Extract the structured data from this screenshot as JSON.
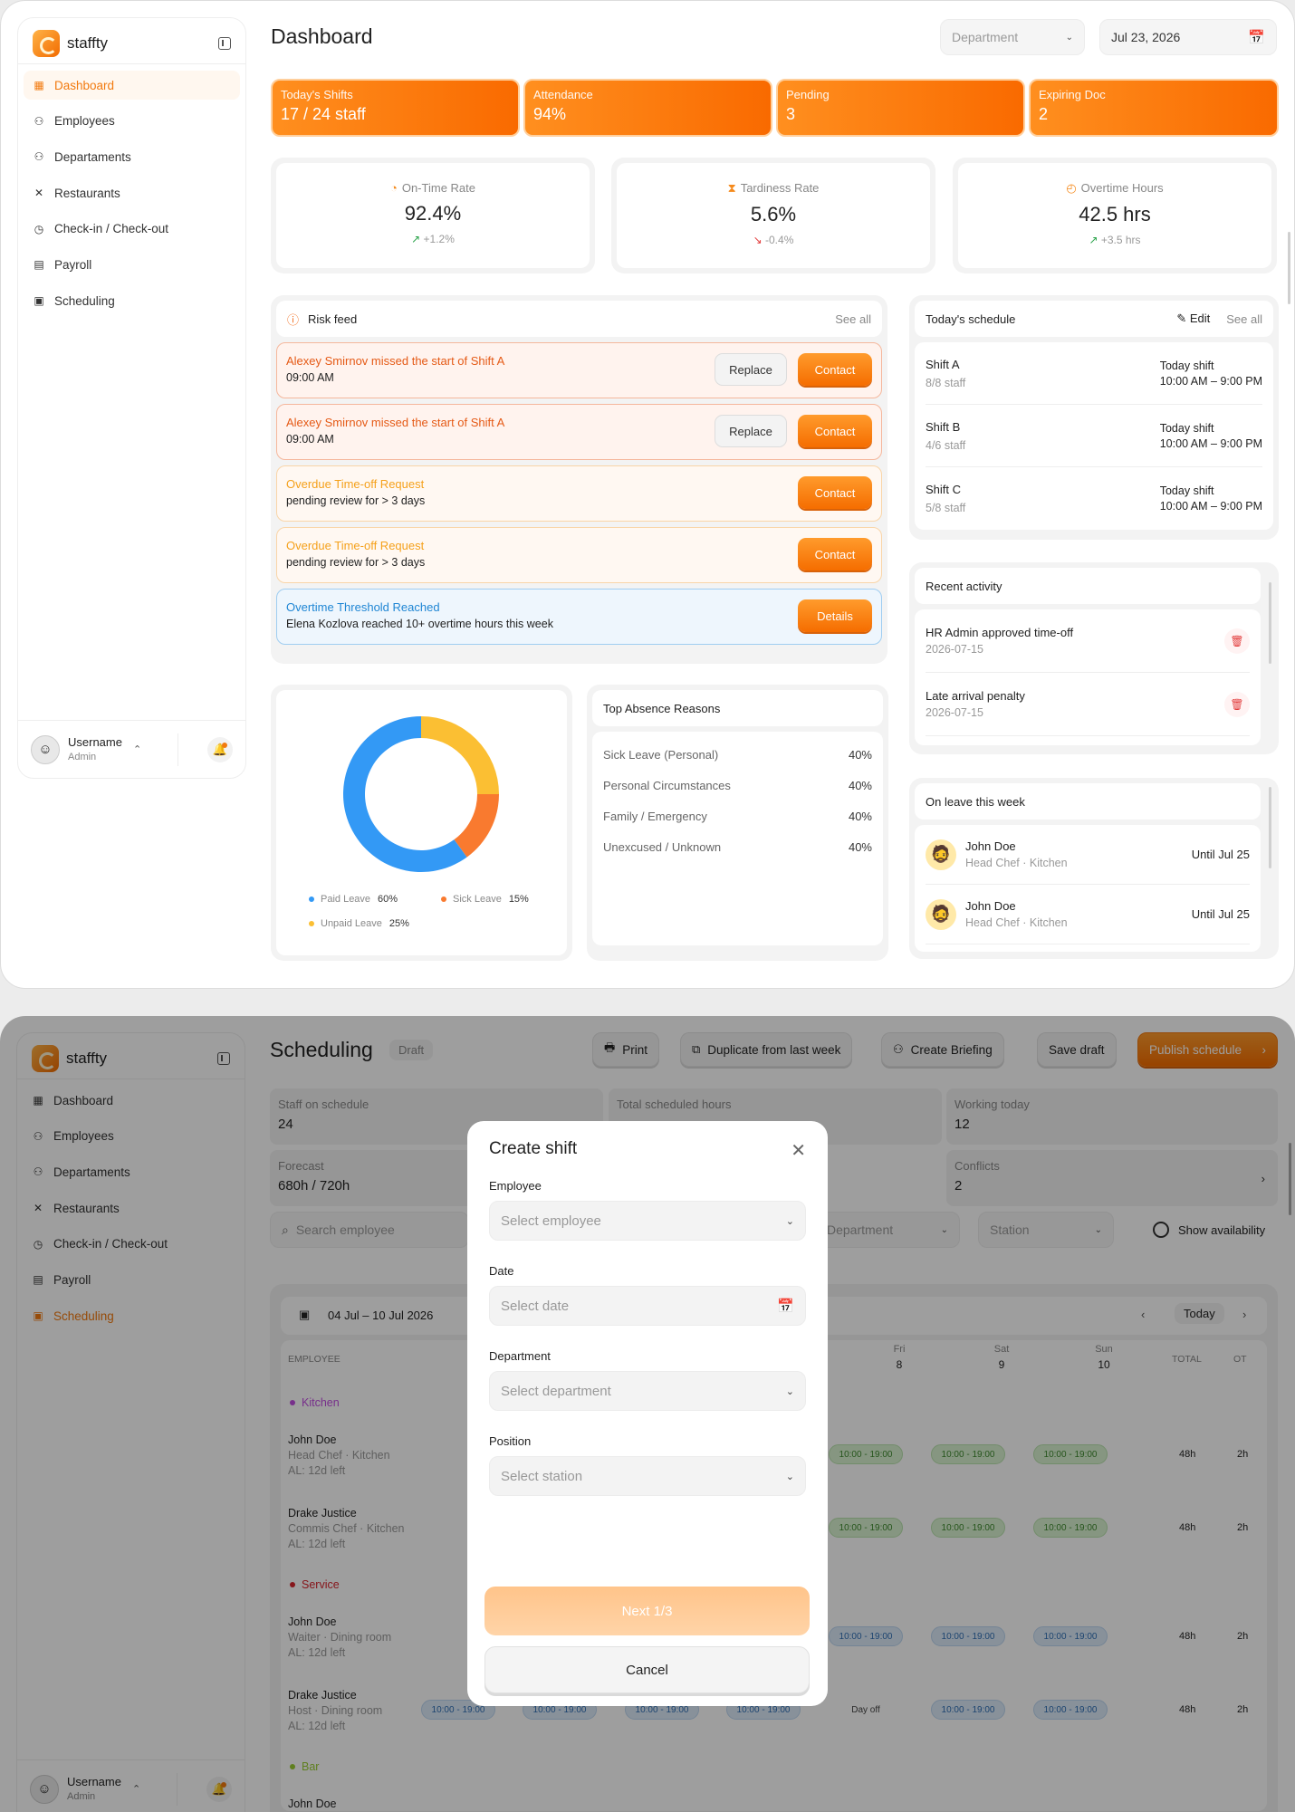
{
  "dashboard": {
    "brand": "staffty",
    "nav": [
      "Dashboard",
      "Employees",
      "Departaments",
      "Restaurants",
      "Check-in / Check-out",
      "Payroll",
      "Scheduling"
    ],
    "user": {
      "name": "Username",
      "role": "Admin"
    },
    "title": "Dashboard",
    "department_select": "Department",
    "date_select": "Jul 23, 2026",
    "kpis": [
      {
        "label": "Today's Shifts",
        "value": "17 / 24 staff"
      },
      {
        "label": "Attendance",
        "value": "94%"
      },
      {
        "label": "Pending",
        "value": "3"
      },
      {
        "label": "Expiring Doc",
        "value": "2"
      }
    ],
    "stats": [
      {
        "label": "On-Time Rate",
        "value": "92.4%",
        "delta": "+1.2%",
        "trend": "up"
      },
      {
        "label": "Tardiness Rate",
        "value": "5.6%",
        "delta": "-0.4%",
        "trend": "down"
      },
      {
        "label": "Overtime Hours",
        "value": "42.5 hrs",
        "delta": "+3.5 hrs",
        "trend": "up"
      }
    ],
    "risk_feed": {
      "title": "Risk feed",
      "see_all": "See all",
      "items": [
        {
          "title": "Alexey Smirnov missed the start of Shift A",
          "sub": "09:00 AM",
          "secondary": "Replace",
          "primary": "Contact"
        },
        {
          "title": "Alexey Smirnov missed the start of Shift A",
          "sub": "09:00 AM",
          "secondary": "Replace",
          "primary": "Contact"
        },
        {
          "title": "Overdue Time-off Request",
          "sub": "pending review for > 3 days",
          "primary": "Contact"
        },
        {
          "title": "Overdue Time-off Request",
          "sub": "pending review for > 3 days",
          "primary": "Contact"
        },
        {
          "title": "Overtime Threshold Reached",
          "sub": "Elena Kozlova reached 10+ overtime hours this week",
          "primary": "Details"
        }
      ]
    },
    "schedule": {
      "title": "Today's schedule",
      "edit": "Edit",
      "see_all": "See all",
      "rows": [
        {
          "shift": "Shift A",
          "staff": "8/8 staff",
          "label": "Today shift",
          "time": "10:00 AM – 9:00 PM"
        },
        {
          "shift": "Shift B",
          "staff": "4/6 staff",
          "label": "Today shift",
          "time": "10:00 AM – 9:00 PM"
        },
        {
          "shift": "Shift C",
          "staff": "5/8 staff",
          "label": "Today shift",
          "time": "10:00 AM – 9:00 PM"
        }
      ]
    },
    "activity": {
      "title": "Recent activity",
      "rows": [
        {
          "text": "HR Admin approved time-off",
          "date": "2026-07-15"
        },
        {
          "text": "Late arrival penalty",
          "date": "2026-07-15"
        }
      ]
    },
    "on_leave": {
      "title": "On leave this week",
      "rows": [
        {
          "name": "John Doe",
          "role": "Head Chef · Kitchen",
          "until": "Until Jul 25"
        },
        {
          "name": "John Doe",
          "role": "Head Chef · Kitchen",
          "until": "Until Jul 25"
        }
      ]
    },
    "leave_chart": {
      "legend": [
        {
          "name": "Paid Leave",
          "pct": "60%",
          "color": "#3399f5"
        },
        {
          "name": "Sick Leave",
          "pct": "15%",
          "color": "#f97a2f"
        },
        {
          "name": "Unpaid Leave",
          "pct": "25%",
          "color": "#fbbf33"
        }
      ]
    },
    "absence": {
      "title": "Top Absence Reasons",
      "rows": [
        {
          "reason": "Sick Leave (Personal)",
          "pct": "40%"
        },
        {
          "reason": "Personal Circumstances",
          "pct": "40%"
        },
        {
          "reason": "Family / Emergency",
          "pct": "40%"
        },
        {
          "reason": "Unexcused / Unknown",
          "pct": "40%"
        }
      ]
    }
  },
  "chart_data": {
    "type": "pie",
    "categories": [
      "Paid Leave",
      "Sick Leave",
      "Unpaid Leave"
    ],
    "values": [
      60,
      15,
      25
    ],
    "colors": [
      "#3399f5",
      "#f97a2f",
      "#fbbf33"
    ]
  },
  "scheduling": {
    "brand": "staffty",
    "nav": [
      "Dashboard",
      "Employees",
      "Departaments",
      "Restaurants",
      "Check-in / Check-out",
      "Payroll",
      "Scheduling"
    ],
    "user": {
      "name": "Username",
      "role": "Admin"
    },
    "title": "Scheduling",
    "badge": "Draft",
    "toolbar": {
      "print": "Print",
      "duplicate": "Duplicate from last week",
      "briefing": "Create Briefing",
      "save": "Save draft",
      "publish": "Publish schedule"
    },
    "summary": [
      {
        "label": "Staff on schedule",
        "value": "24"
      },
      {
        "label": "Total scheduled hours",
        "value": ""
      },
      {
        "label": "Working today",
        "value": "12"
      },
      {
        "label": "Forecast",
        "value": "680h / 720h"
      },
      {
        "label": "Conflicts",
        "value": "2"
      }
    ],
    "search_placeholder": "Search employee",
    "department_filter": "Department",
    "station_filter": "Station",
    "show_availability": "Show availability",
    "week_range": "04 Jul – 10 Jul 2026",
    "today": "Today",
    "columns": {
      "employee": "EMPLOYEE",
      "total": "TOTAL",
      "ot": "OT"
    },
    "days": [
      {
        "d": "Fri",
        "n": "8"
      },
      {
        "d": "Sat",
        "n": "9"
      },
      {
        "d": "Sun",
        "n": "10"
      }
    ],
    "groups": [
      {
        "name": "Kitchen",
        "color": "#c14de0",
        "rows": [
          {
            "name": "John Doe",
            "role": "Head Chef · Kitchen",
            "al": "AL: 12d left",
            "shifts": [
              "10:00 - 19:00",
              "10:00 - 19:00",
              "10:00 - 19:00"
            ],
            "total": "48h",
            "ot": "2h"
          },
          {
            "name": "Drake Justice",
            "role": "Commis Chef · Kitchen",
            "al": "AL: 12d left",
            "shifts": [
              "10:00 - 19:00",
              "10:00 - 19:00",
              "10:00 - 19:00"
            ],
            "total": "48h",
            "ot": "2h"
          }
        ]
      },
      {
        "name": "Service",
        "color": "#d8242d",
        "rows": [
          {
            "name": "John Doe",
            "role": "Waiter · Dining room",
            "al": "AL: 12d left",
            "shifts": [
              "10:00 - 19:00",
              "10:00 - 19:00",
              "10:00 - 19:00"
            ],
            "total": "48h",
            "ot": "2h"
          },
          {
            "name": "Drake Justice",
            "role": "Host · Dining room",
            "al": "AL: 12d left",
            "shifts": [
              "10:00 - 19:00",
              "10:00 - 19:00",
              "10:00 - 19:00",
              "10:00 - 19:00",
              "Day off",
              "10:00 - 19:00",
              "10:00 - 19:00"
            ],
            "total": "48h",
            "ot": "2h"
          }
        ]
      },
      {
        "name": "Bar",
        "color": "#9acd32",
        "rows": [
          {
            "name": "John Doe"
          }
        ]
      }
    ],
    "modal": {
      "title": "Create shift",
      "employee_label": "Employee",
      "employee_placeholder": "Select employee",
      "date_label": "Date",
      "date_placeholder": "Select date",
      "department_label": "Department",
      "department_placeholder": "Select department",
      "position_label": "Position",
      "position_placeholder": "Select station",
      "next": "Next 1/3",
      "cancel": "Cancel"
    }
  }
}
